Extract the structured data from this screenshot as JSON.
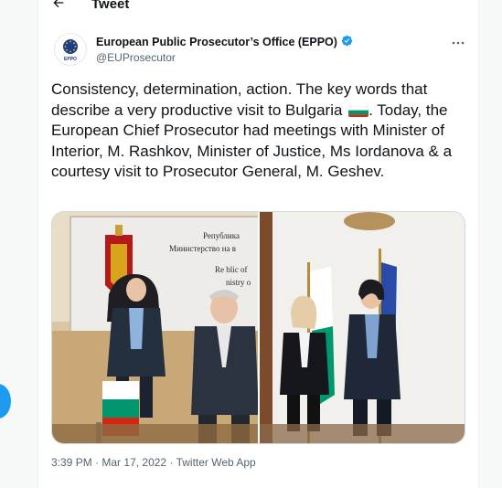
{
  "header": {
    "title": "Tweet",
    "back_icon": "arrow-left-icon"
  },
  "author": {
    "name": "European Public Prosecutor’s Office (EPPO)",
    "handle": "@EUProsecutor",
    "verified_icon": "verified-badge-icon",
    "avatar_text": "EPPO"
  },
  "tweet": {
    "text_before_flag": "Consistency, determination, action. The key words that describe a very productive visit to Bulgaria ",
    "flag_icon": "bulgaria-flag-icon",
    "text_after_flag": ". Today, the European Chief Prosecutor had meetings with Minister of Interior, M. Rashkov, Minister of Justice, Ms Iordanova & a courtesy visit to Prosecutor General, M. Geshev.",
    "photos": [
      {
        "sign_lines": [
          "Република",
          "Министерство на в",
          "Re   blic of",
          "nistry o"
        ]
      },
      {
        "sign_lines": []
      }
    ],
    "time": "3:39 PM",
    "separator": "·",
    "date": "Mar 17, 2022",
    "source": "Twitter Web App"
  },
  "colors": {
    "accent": "#1d9bf0",
    "text": "#0f1419",
    "secondary": "#536471",
    "bg": "#f7f9f9"
  }
}
